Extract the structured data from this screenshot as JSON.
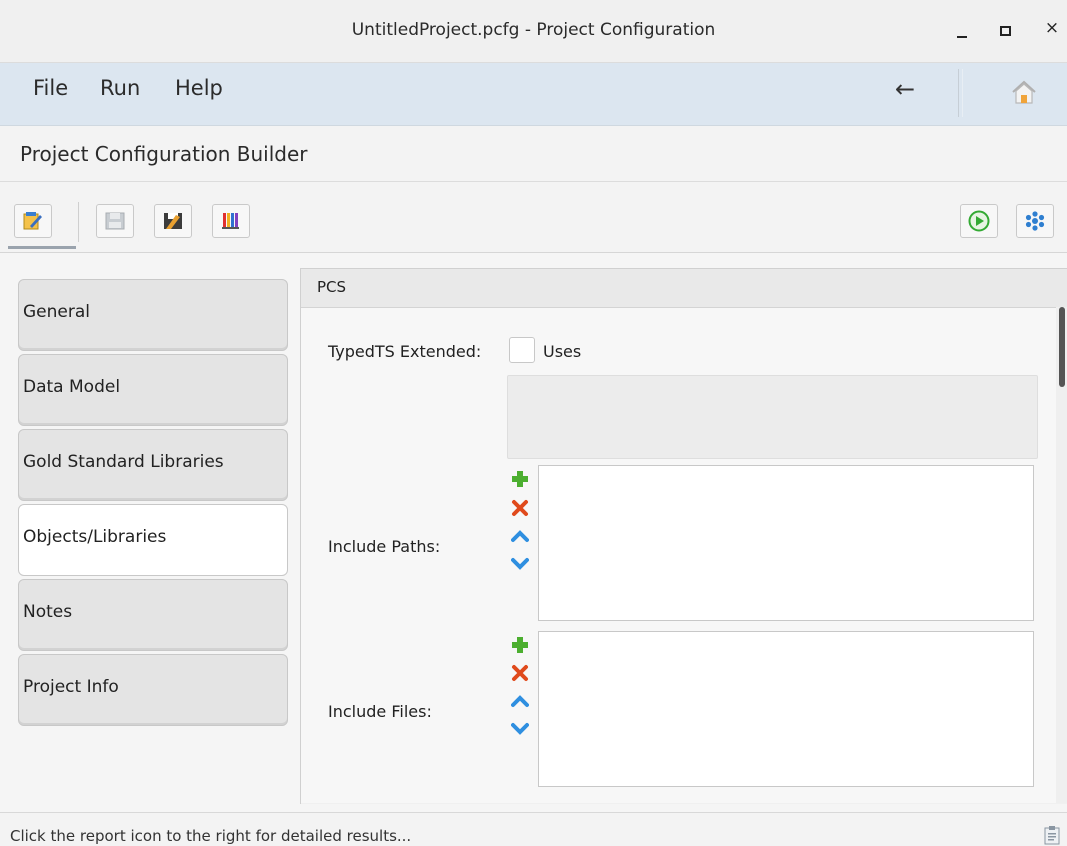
{
  "window": {
    "title": "UntitledProject.pcfg - Project Configuration",
    "controls": {
      "minimize": "minimize",
      "maximize": "maximize",
      "close": "×"
    }
  },
  "menu": {
    "items": [
      "File",
      "Run",
      "Help"
    ],
    "back_glyph": "←"
  },
  "header": {
    "title": "Project Configuration Builder"
  },
  "toolbar": {
    "buttons": [
      "edit-icon",
      "save-icon",
      "save-as-icon",
      "library-icon"
    ],
    "right_buttons": [
      "run-icon",
      "settings-icon"
    ],
    "colors": {
      "run": "#33aa33",
      "settings": "#2f7fd0"
    }
  },
  "tabs": [
    {
      "label": "General",
      "active": false
    },
    {
      "label": "Data Model",
      "active": false
    },
    {
      "label": "Gold Standard Libraries",
      "active": false
    },
    {
      "label": "Objects/Libraries",
      "active": true
    },
    {
      "label": "Notes",
      "active": false
    },
    {
      "label": "Project Info",
      "active": false
    }
  ],
  "panel": {
    "title": "PCS",
    "typedts": {
      "label": "TypedTS Extended:",
      "checkbox_label": "Uses",
      "checked": false
    },
    "include_paths": {
      "label": "Include Paths:"
    },
    "include_files": {
      "label": "Include Files:"
    },
    "list_controls": [
      "add-icon",
      "remove-icon",
      "move-up-icon",
      "move-down-icon"
    ],
    "colors": {
      "add": "#4caf30",
      "remove": "#e04a1c",
      "move": "#2f8fe0"
    }
  },
  "status": {
    "message": "Click the report icon to the right for detailed results..."
  }
}
